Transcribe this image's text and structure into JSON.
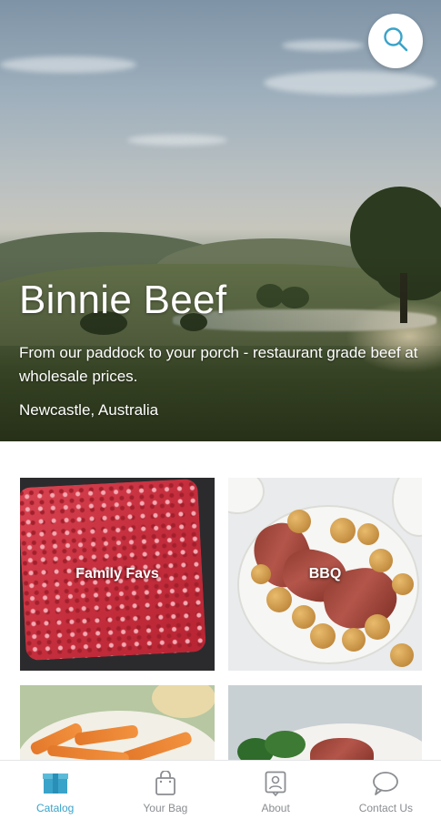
{
  "hero": {
    "title": "Binnie Beef",
    "tagline": "From our paddock to your porch - restaurant grade beef at wholesale prices.",
    "location": "Newcastle, Australia"
  },
  "search": {
    "icon": "search-icon"
  },
  "categories": [
    {
      "label": "Family Favs"
    },
    {
      "label": "BBQ"
    },
    {
      "label": ""
    },
    {
      "label": ""
    }
  ],
  "nav": {
    "active": "Catalog",
    "items": [
      {
        "label": "Catalog",
        "icon": "catalog-box-icon"
      },
      {
        "label": "Your Bag",
        "icon": "shopping-bag-icon"
      },
      {
        "label": "About",
        "icon": "about-person-icon"
      },
      {
        "label": "Contact Us",
        "icon": "chat-bubble-icon"
      }
    ]
  },
  "colors": {
    "accent": "#3aa3c9",
    "nav_inactive": "#8a8d91",
    "hero_text": "#ffffff"
  }
}
